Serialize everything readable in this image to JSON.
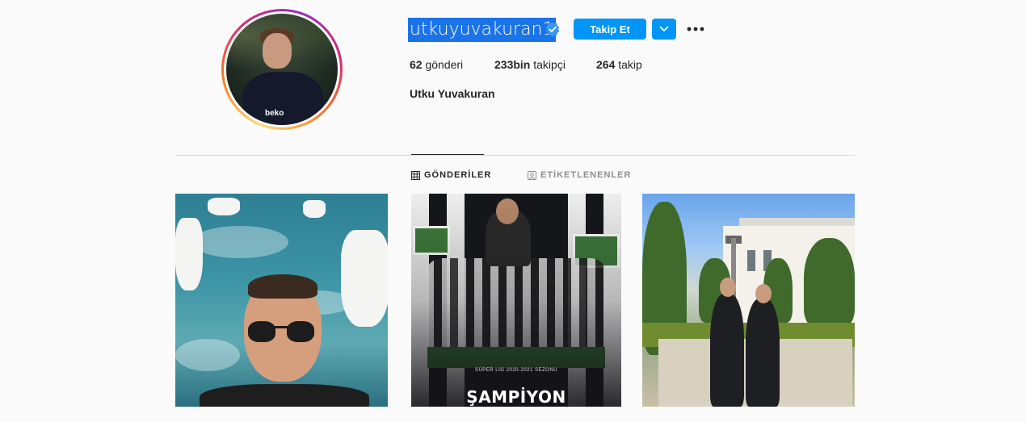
{
  "profile": {
    "username": "utkuyuvakuran1",
    "verified": true,
    "follow_label": "Takip Et",
    "full_name": "Utku Yuvakuran",
    "avatar_logo_text": "beko"
  },
  "stats": [
    {
      "value": "62",
      "label": "gönderi"
    },
    {
      "value": "233bin",
      "label": "takipçi"
    },
    {
      "value": "264",
      "label": "takip"
    }
  ],
  "tabs": [
    {
      "label": "GÖNDERİLER",
      "icon": "grid-icon",
      "active": true
    },
    {
      "label": "ETİKETLENENLER",
      "icon": "tagged-icon",
      "active": false
    }
  ],
  "posts": [
    {
      "subject": "boat-selfie"
    },
    {
      "subject": "champions-poster",
      "subtitle": "SÜPER LİG 2020-2021 SEZONU",
      "title": "ŞAMPİYON"
    },
    {
      "subject": "two-players-garden"
    }
  ],
  "colors": {
    "accent": "#0095f6",
    "verified": "#3897f0",
    "selection": "#1a73e8",
    "text": "#262626",
    "muted": "#8e8e8e",
    "border": "#dbdbdb",
    "background": "#fafafa"
  }
}
